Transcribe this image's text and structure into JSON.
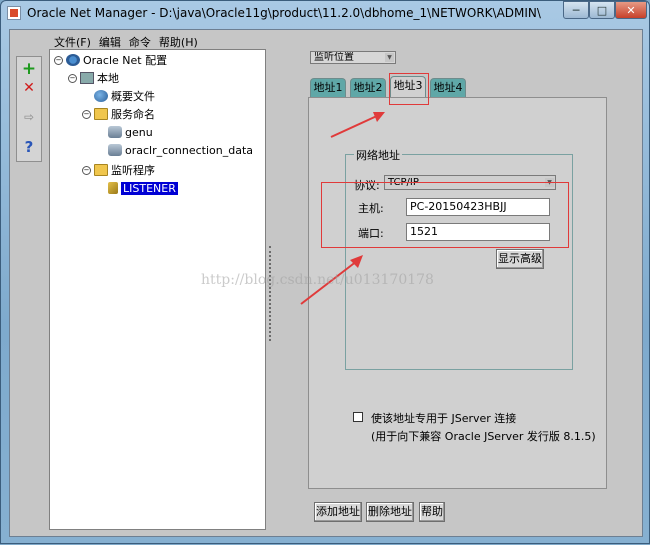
{
  "window": {
    "title": "Oracle Net Manager - D:\\java\\Oracle11g\\product\\11.2.0\\dbhome_1\\NETWORK\\ADMIN\\",
    "min_label": "─",
    "max_label": "□",
    "close_label": "✕"
  },
  "menu": [
    "文件(F)",
    "编辑",
    "命令",
    "帮助(H)"
  ],
  "toolbar": {
    "add": "+",
    "remove": "✕",
    "test": "⇨",
    "help": "?"
  },
  "tree": {
    "root": "Oracle Net 配置",
    "local": "本地",
    "profile": "概要文件",
    "naming": "服务命名",
    "genu": "genu",
    "oraclr": "oraclr_connection_data",
    "listeners": "监听程序",
    "listener": "LISTENER"
  },
  "listen_location": {
    "value": "监听位置",
    "options": [
      "监听位置"
    ]
  },
  "tabs": [
    "地址1",
    "地址2",
    "地址3",
    "地址4"
  ],
  "active_tab": "地址3",
  "address": {
    "group_label": "网络地址",
    "protocol_label": "协议:",
    "protocol": "TCP/IP",
    "host_label": "主机:",
    "host": "PC-20150423HBJJ",
    "port_label": "端口:",
    "port": "1521",
    "advanced_button": "显示高级"
  },
  "jserver": {
    "label": "使该地址专用于 JServer 连接",
    "note": "(用于向下兼容 Oracle JServer 发行版 8.1.5)",
    "checked": false
  },
  "buttons": {
    "add_address": "添加地址",
    "delete_address": "删除地址",
    "help": "帮助"
  },
  "watermark": "http://blog.csdn.net/u013170178",
  "colors": {
    "annotation": "#e03a3a",
    "selection": "#0000d4",
    "tab": "#5fa7a7"
  }
}
